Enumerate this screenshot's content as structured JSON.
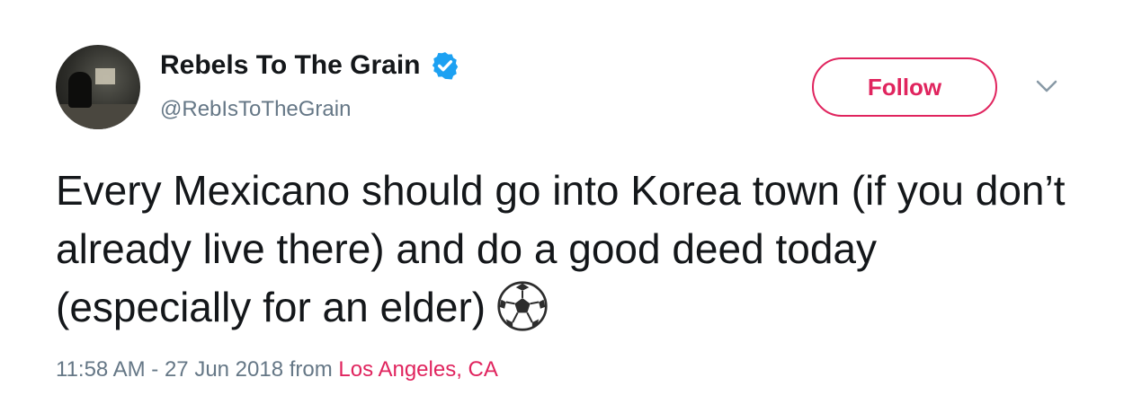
{
  "author": {
    "display_name": "Rebels To The Grain",
    "handle": "@RebIsToTheGrain",
    "verified": true,
    "verified_color": "#1da1f2"
  },
  "actions": {
    "follow_label": "Follow",
    "accent_color": "#e0245e",
    "menu_icon": "chevron-down-icon"
  },
  "tweet": {
    "text": "Every Mexicano should go into Korea town (if you don’t already live there) and do a good deed today (especially for an elder)",
    "emoji": "soccer-ball-icon"
  },
  "meta": {
    "timestamp": "11:58 AM - 27 Jun 2018",
    "from_label": "from",
    "location": "Los Angeles, CA"
  }
}
